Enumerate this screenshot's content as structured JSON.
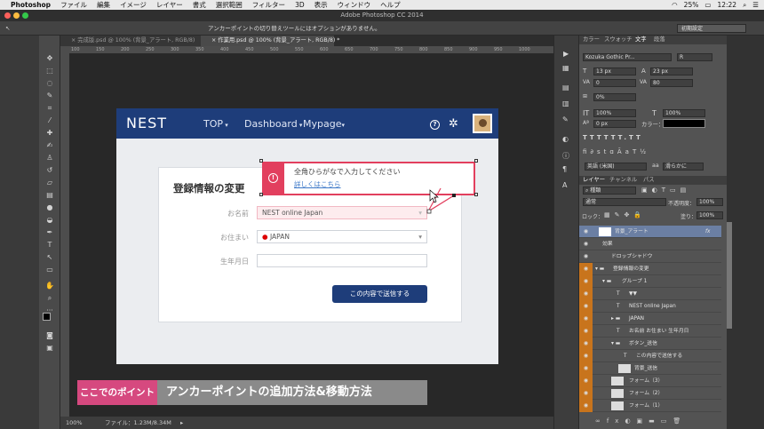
{
  "menubar": {
    "app": "Photoshop",
    "items": [
      "ファイル",
      "編集",
      "イメージ",
      "レイヤー",
      "書式",
      "選択範囲",
      "フィルター",
      "3D",
      "表示",
      "ウィンドウ",
      "ヘルプ"
    ],
    "battery": "25%",
    "time": "12:22"
  },
  "window": {
    "title": "Adobe Photoshop CC 2014"
  },
  "options": {
    "message": "アンカーポイントの切り替えツールにはオプションがありません。",
    "preset": "初期設定"
  },
  "tabs": [
    {
      "label": "完成版.psd @ 100% (背景_アラート, RGB/8)"
    },
    {
      "label": "作業用.psd @ 100% (背景_アラート, RGB/8) *"
    }
  ],
  "ruler": {
    "marks": [
      "100",
      "150",
      "200",
      "250",
      "300",
      "350",
      "400",
      "450",
      "500",
      "550",
      "600",
      "650",
      "700",
      "750",
      "800",
      "850",
      "900",
      "950",
      "1000"
    ]
  },
  "status": {
    "zoom": "100%",
    "file": "ファイル：1.23M/8.34M"
  },
  "site": {
    "logo": "NEST",
    "nav": [
      "TOP",
      "Dashboard",
      "Mypage"
    ],
    "form_title": "登録情報の変更",
    "labels": [
      "お名前",
      "お住まい",
      "生年月日"
    ],
    "name_value": "NEST online Japan",
    "country_value": "JAPAN",
    "submit": "この内容で送信する",
    "alert_text": "全角ひらがなで入力してください",
    "alert_link": "詳しくはこちら"
  },
  "caption": {
    "left": "ここでのポイント",
    "right": "アンカーポイントの追加方法&移動方法"
  },
  "char_panel": {
    "tabs": [
      "カラー",
      "スウォッチ",
      "文字",
      "段落"
    ],
    "font": "Kozuka Gothic Pr...",
    "style": "R",
    "size": "13 px",
    "leading": "23 px",
    "kerning": "0",
    "tracking": "80",
    "scale": "0%",
    "vscale": "100%",
    "hscale": "100%",
    "baseline": "0 px",
    "color_label": "カラー：",
    "lang": "英語 (米国)",
    "aa_label": "aa",
    "aa": "滑らかに"
  },
  "layers_panel": {
    "tabs": [
      "レイヤー",
      "チャンネル",
      "パス"
    ],
    "filter": "種類",
    "blend": "通常",
    "opacity_label": "不透明度：",
    "opacity": "100%",
    "lock_label": "ロック：",
    "fill_label": "塗り：",
    "fill": "100%",
    "rows": [
      {
        "name": "背景_アラート",
        "type": "shape",
        "fx": "fx"
      },
      {
        "name": "効果",
        "type": "effect"
      },
      {
        "name": "ドロップシャドウ",
        "type": "effect"
      },
      {
        "name": "登録情報の変更",
        "type": "folder"
      },
      {
        "name": "グループ 1",
        "type": "folder"
      },
      {
        "name": "▼▼",
        "type": "text"
      },
      {
        "name": "NEST online Japan",
        "type": "text"
      },
      {
        "name": "JAPAN",
        "type": "folder"
      },
      {
        "name": "お名前 お住まい 生年月日",
        "type": "text"
      },
      {
        "name": "ボタン_送信",
        "type": "folder"
      },
      {
        "name": "この内容で送信する",
        "type": "text"
      },
      {
        "name": "背景_送信",
        "type": "shape"
      },
      {
        "name": "フォーム（3）",
        "type": "shape"
      },
      {
        "name": "フォーム（2）",
        "type": "shape"
      },
      {
        "name": "フォーム（1）",
        "type": "shape"
      }
    ]
  },
  "colors": {
    "nav": "#1e3d7a",
    "alert": "#e23f5e",
    "caption_pink": "#d6497f"
  }
}
